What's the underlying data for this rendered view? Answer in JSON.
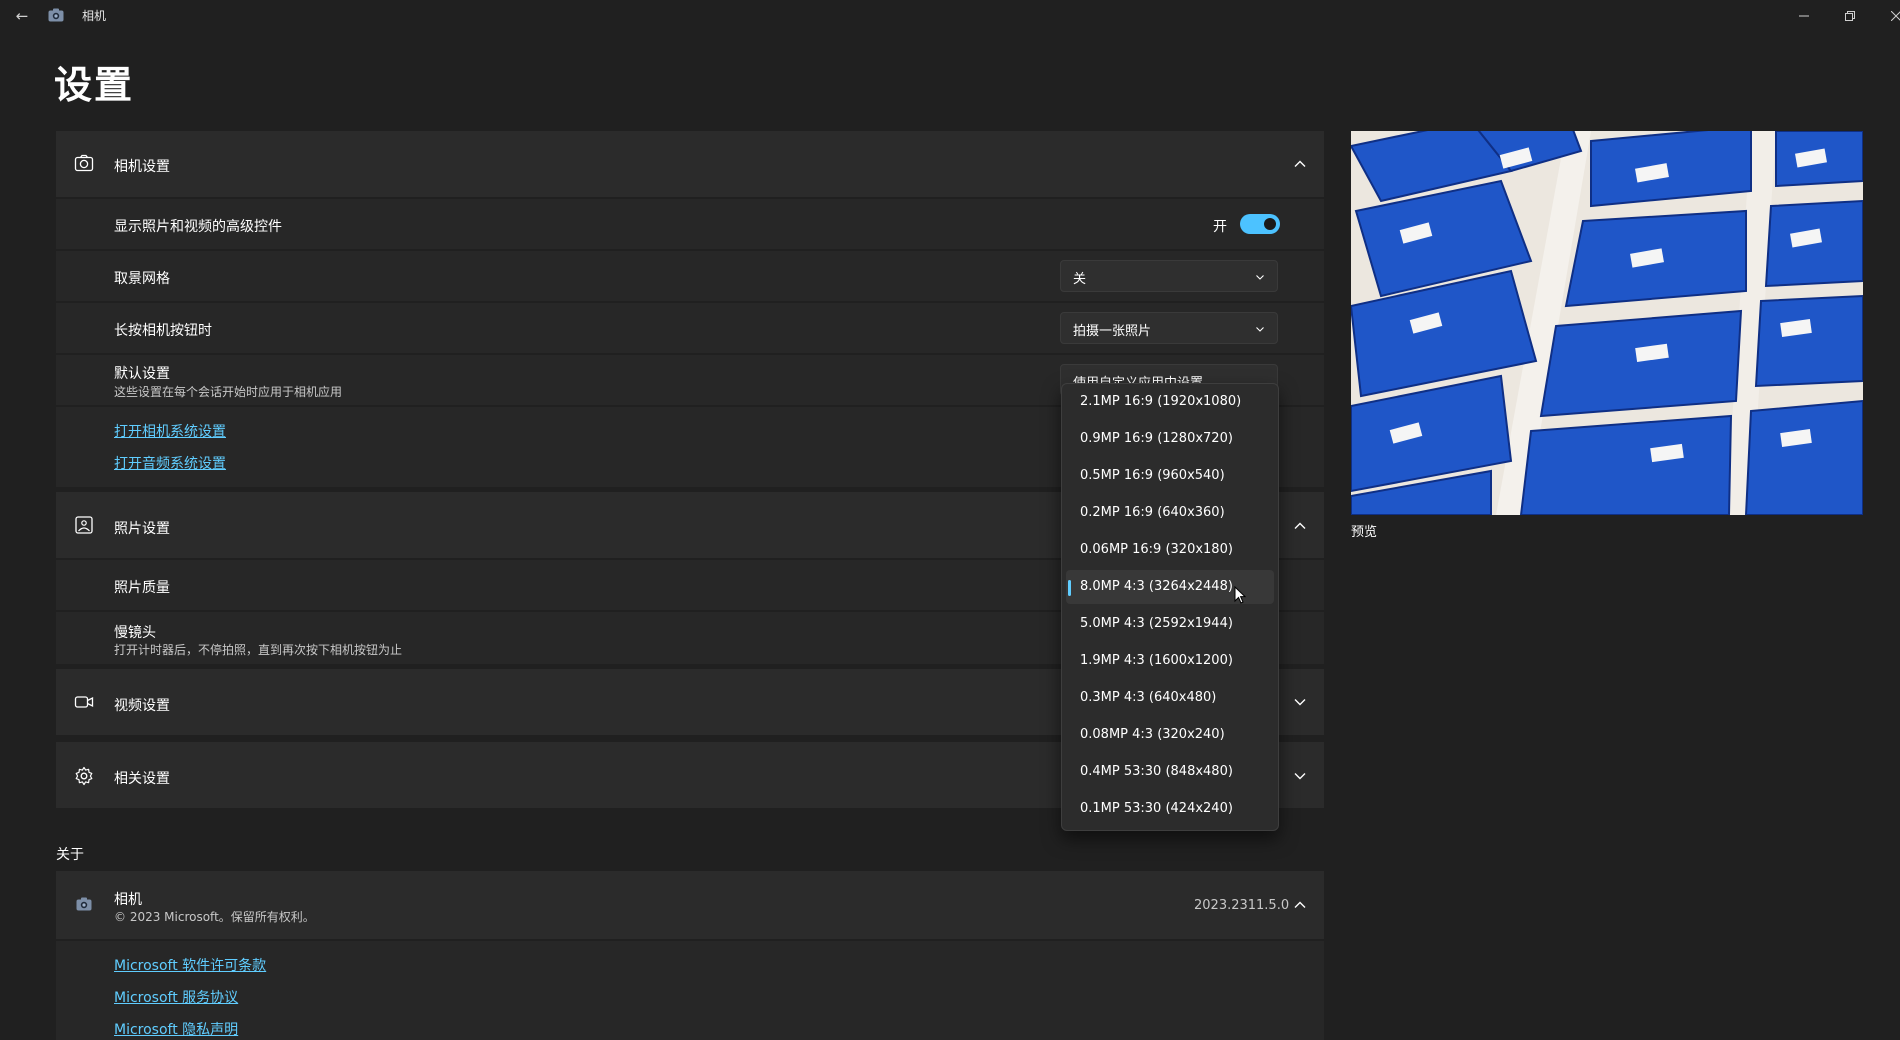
{
  "window": {
    "title": "相机"
  },
  "page": {
    "title": "设置"
  },
  "camera_settings": {
    "title": "相机设置",
    "advanced_controls": {
      "label": "显示照片和视频的高级控件",
      "state": "开"
    },
    "framing_grid": {
      "label": "取景网格",
      "value": "关"
    },
    "hold_button": {
      "label": "长按相机按钮时",
      "value": "拍摄一张照片"
    },
    "defaults": {
      "label": "默认设置",
      "desc": "这些设置在每个会话开始时应用于相机应用",
      "value": "使用自定义应用中设置"
    },
    "links": {
      "camera_system": "打开相机系统设置",
      "audio_system": "打开音频系统设置"
    }
  },
  "photo_settings": {
    "title": "照片设置",
    "quality": {
      "label": "照片质量"
    },
    "time_lapse": {
      "label": "慢镜头",
      "desc": "打开计时器后，不停拍照，直到再次按下相机按钮为止"
    }
  },
  "video_settings": {
    "title": "视频设置"
  },
  "related_settings": {
    "title": "相关设置"
  },
  "about": {
    "heading": "关于",
    "app_name": "相机",
    "copyright": "© 2023 Microsoft。保留所有权利。",
    "version": "2023.2311.5.0",
    "links": {
      "license": "Microsoft 软件许可条款",
      "service": "Microsoft 服务协议",
      "privacy": "Microsoft 隐私声明"
    }
  },
  "quality_dropdown": {
    "options": [
      "2.1MP 16:9 (1920x1080)",
      "0.9MP 16:9 (1280x720)",
      "0.5MP 16:9 (960x540)",
      "0.2MP 16:9 (640x360)",
      "0.06MP 16:9 (320x180)",
      "8.0MP 4:3 (3264x2448)",
      "5.0MP 4:3 (2592x1944)",
      "1.9MP 4:3 (1600x1200)",
      "0.3MP 4:3 (640x480)",
      "0.08MP 4:3 (320x240)",
      "0.4MP 53:30 (848x480)",
      "0.1MP 53:30 (424x240)"
    ],
    "selected_index": 5
  },
  "preview": {
    "label": "预览"
  },
  "colors": {
    "accent": "#60cdff",
    "toggle_on": "#4cc2ff",
    "background": "#202020",
    "card": "#2b2b2b"
  }
}
